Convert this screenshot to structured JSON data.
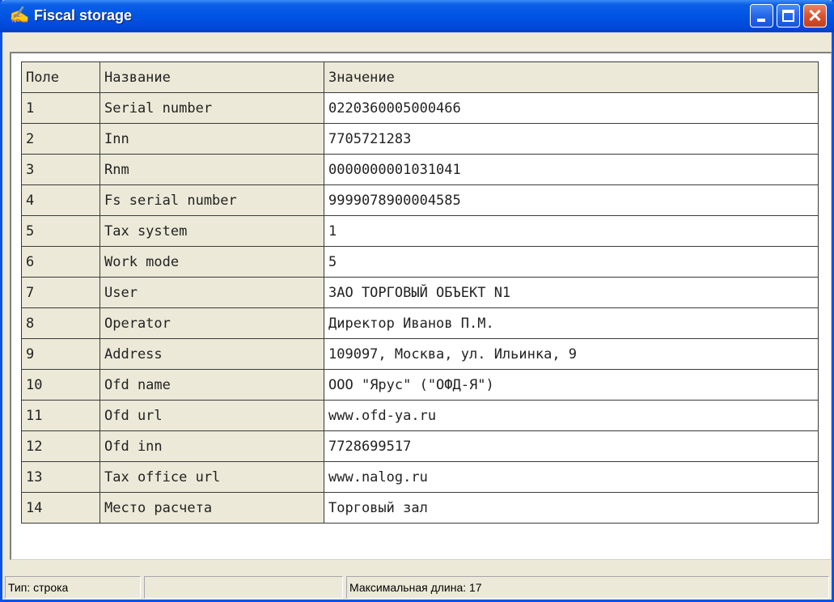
{
  "window": {
    "title": "Fiscal storage"
  },
  "table": {
    "headers": [
      "Поле",
      "Название",
      "Значение"
    ],
    "rows": [
      [
        "1",
        "Serial number",
        "0220360005000466"
      ],
      [
        "2",
        "Inn",
        "7705721283"
      ],
      [
        "3",
        "Rnm",
        "0000000001031041"
      ],
      [
        "4",
        "Fs serial number",
        "9999078900004585"
      ],
      [
        "5",
        "Tax system",
        "1"
      ],
      [
        "6",
        "Work mode",
        "5"
      ],
      [
        "7",
        "User",
        "ЗАО ТОРГОВЫЙ ОБЪЕКТ N1"
      ],
      [
        "8",
        "Operator",
        "Директор Иванов П.М."
      ],
      [
        "9",
        "Address",
        "109097, Москва, ул. Ильинка, 9"
      ],
      [
        "10",
        "Ofd name",
        "ООО \"Ярус\" (\"ОФД-Я\")"
      ],
      [
        "11",
        "Ofd url",
        "www.ofd-ya.ru"
      ],
      [
        "12",
        "Ofd inn",
        "7728699517"
      ],
      [
        "13",
        "Tax office url",
        "www.nalog.ru"
      ],
      [
        "14",
        "Место расчета",
        "Торговый зал"
      ]
    ]
  },
  "statusbar": {
    "type": "Тип: строка",
    "middle": "",
    "maxlen": "Максимальная длина: 17"
  }
}
